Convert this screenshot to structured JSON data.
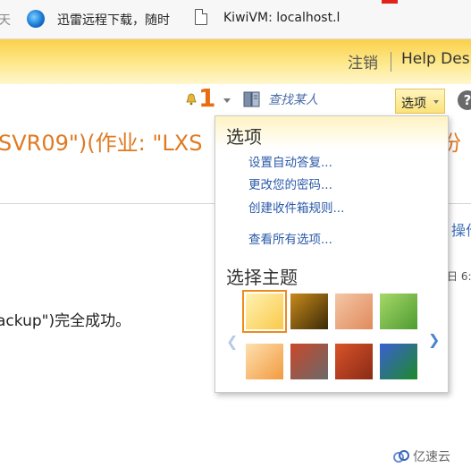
{
  "bookmarks": {
    "item_cut": "天",
    "item_xunlei": "迅雷远程下载，随时",
    "item_kiwivm": "KiwiVM: localhost.l"
  },
  "header": {
    "signout": "注销",
    "helpdesk": "Help Desk"
  },
  "toolbar": {
    "notification_count": "1",
    "find_placeholder": "查找某人",
    "options_label": "选项",
    "help_glyph": "?"
  },
  "message": {
    "title_partial": "SVR09\")(作业: \"LXS",
    "title_right_partial": "份",
    "action_partial": "操作",
    "date_partial": "日 6:",
    "body_partial": "ackup\")完全成功。"
  },
  "options_menu": {
    "title": "选项",
    "items": [
      "设置自动答复...",
      "更改您的密码...",
      "创建收件箱规则...",
      "查看所有选项..."
    ],
    "theme_title": "选择主题",
    "themes": [
      {
        "name": "theme-sunshine",
        "colors": [
          "#fff2b3",
          "#f9c94a"
        ]
      },
      {
        "name": "theme-bees",
        "colors": [
          "#c98a1a",
          "#3a2a08"
        ]
      },
      {
        "name": "theme-fruit",
        "colors": [
          "#f4c7a5",
          "#e08a5c"
        ]
      },
      {
        "name": "theme-leaves",
        "colors": [
          "#a6d86a",
          "#4e9b2e"
        ]
      },
      {
        "name": "theme-balloons",
        "colors": [
          "#fde0b0",
          "#f29a3f"
        ]
      },
      {
        "name": "theme-robot",
        "colors": [
          "#c9472a",
          "#6a6a6a"
        ]
      },
      {
        "name": "theme-autumn",
        "colors": [
          "#d9532a",
          "#8a2a16"
        ]
      },
      {
        "name": "theme-monster",
        "colors": [
          "#3b5fd4",
          "#1d8a2a"
        ]
      }
    ],
    "selected_theme": "theme-sunshine"
  },
  "watermark": {
    "text": "亿速云"
  },
  "colors": {
    "accent_orange": "#e07a22",
    "link_blue": "#2a5aa8",
    "header_yellow": "#fbd04a"
  }
}
